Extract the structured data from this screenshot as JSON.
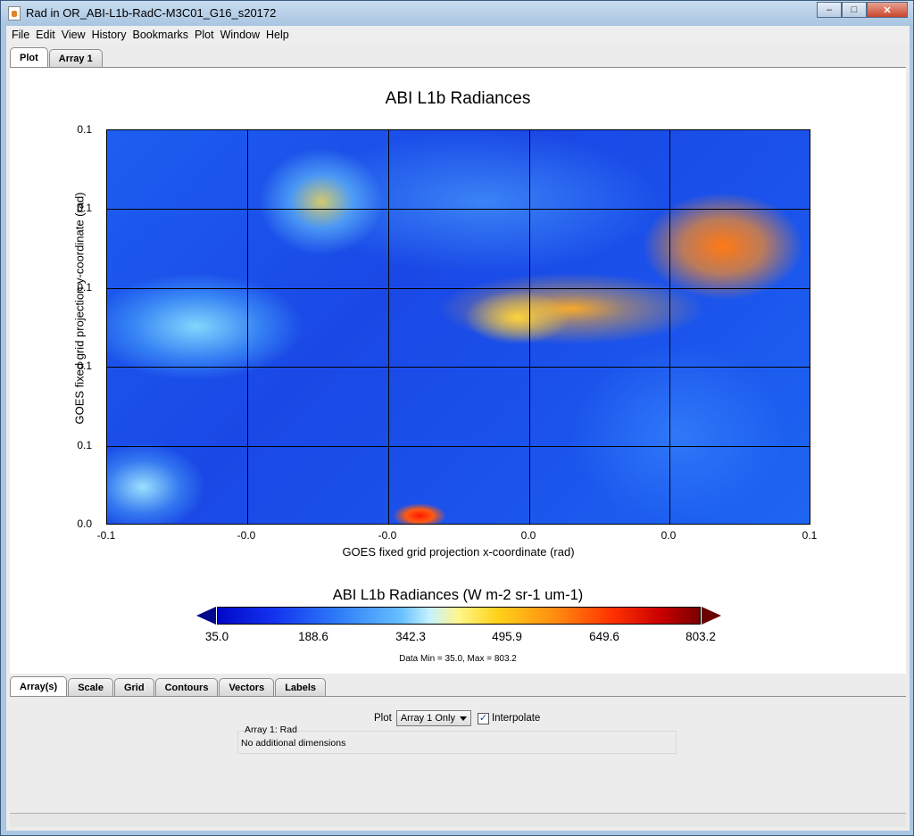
{
  "window": {
    "title": "Rad in OR_ABI-L1b-RadC-M3C01_G16_s20172",
    "minimize": "–",
    "maximize": "□",
    "close": "✕"
  },
  "menu": [
    "File",
    "Edit",
    "View",
    "History",
    "Bookmarks",
    "Plot",
    "Window",
    "Help"
  ],
  "top_tabs": [
    "Plot",
    "Array 1"
  ],
  "plot": {
    "title": "ABI L1b Radiances",
    "xlabel": "GOES fixed grid projection x-coordinate (rad)",
    "ylabel": "GOES fixed grid projection y-coordinate (rad)",
    "x_ticks": [
      "-0.1",
      "-0.0",
      "-0.0",
      "0.0",
      "0.0",
      "0.1"
    ],
    "y_ticks": [
      "0.1",
      "0.1",
      "0.1",
      "0.1",
      "0.1",
      "0.0"
    ]
  },
  "colorbar": {
    "title": "ABI L1b Radiances (W m-2 sr-1 um-1)",
    "ticks": [
      "35.0",
      "188.6",
      "342.3",
      "495.9",
      "649.6",
      "803.2"
    ],
    "minmax": "Data Min = 35.0, Max = 803.2"
  },
  "bottom_tabs": [
    "Array(s)",
    "Scale",
    "Grid",
    "Contours",
    "Vectors",
    "Labels"
  ],
  "controls": {
    "plot_label": "Plot",
    "plot_select": "Array 1 Only",
    "interpolate_label": "Interpolate",
    "interpolate_checked": true,
    "check_mark": "✓",
    "array_legend": "Array 1: Rad",
    "array_info": "No additional dimensions"
  }
}
